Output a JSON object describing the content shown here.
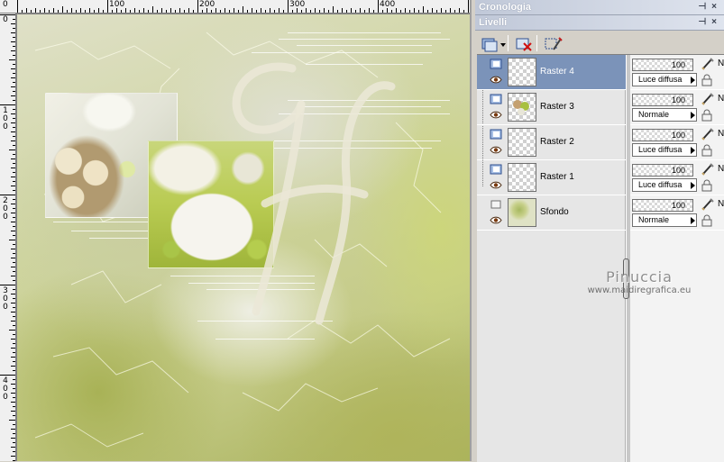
{
  "rulers": {
    "top_labels": [
      "0",
      "100",
      "200",
      "300",
      "400"
    ],
    "left_labels": [
      "0",
      "100",
      "200",
      "300",
      "400"
    ]
  },
  "panels": {
    "history_title": "Cronologia",
    "layers_title": "Livelli"
  },
  "toolbar": {
    "new_layer_icon": "new-layer-icon",
    "delete_layer_icon": "delete-layer-icon",
    "layer_properties_icon": "layer-properties-icon"
  },
  "layers": [
    {
      "name": "Raster 4",
      "opacity": "100",
      "blend": "Luce diffusa",
      "selected": true,
      "thumb": "transparent"
    },
    {
      "name": "Raster 3",
      "opacity": "100",
      "blend": "Normale",
      "selected": false,
      "thumb": "flowers"
    },
    {
      "name": "Raster 2",
      "opacity": "100",
      "blend": "Luce diffusa",
      "selected": false,
      "thumb": "transparent"
    },
    {
      "name": "Raster 1",
      "opacity": "100",
      "blend": "Luce diffusa",
      "selected": false,
      "thumb": "transparent"
    },
    {
      "name": "Sfondo",
      "opacity": "100",
      "blend": "Normale",
      "selected": false,
      "thumb": "background"
    }
  ],
  "layer_prop_cutoff_letter": "N",
  "watermark": {
    "name": "Pinuccia",
    "url": "www.maidiregrafica.eu"
  },
  "colors": {
    "selection": "#7b93b9",
    "panel_bg": "#d4d0c8",
    "title_bar": "#c0c8d8"
  }
}
